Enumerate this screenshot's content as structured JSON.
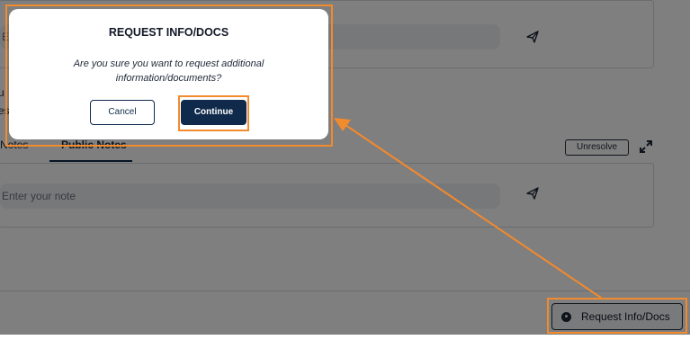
{
  "notes": {
    "top_input_placeholder": "E",
    "bottom_input_placeholder": "Enter your note",
    "tabs": [
      {
        "label": "e Notes"
      },
      {
        "label": "Public Notes"
      }
    ],
    "side_text_1": "u",
    "side_text_2": "es"
  },
  "actions": {
    "unresolve_label": "Unresolve",
    "request_info_label": "Request Info/Docs"
  },
  "modal": {
    "title": "REQUEST INFO/DOCS",
    "body": "Are you sure you want to request additional information/documents?",
    "cancel_label": "Cancel",
    "continue_label": "Continue"
  },
  "colors": {
    "accent": "#0f2a4a",
    "highlight": "#f28a2e",
    "overlay": "rgba(0,0,0,0.5)"
  }
}
